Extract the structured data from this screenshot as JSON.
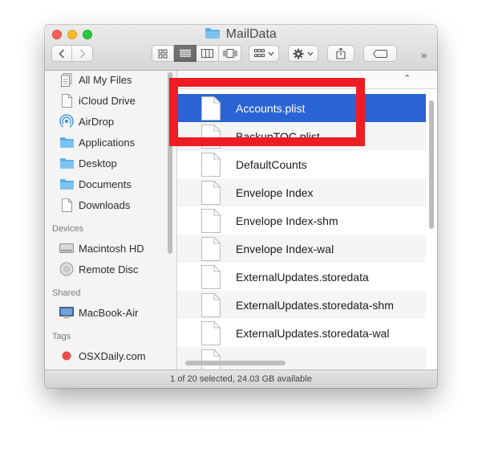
{
  "window": {
    "title": "MailData",
    "title_icon": "folder-icon",
    "controls": [
      "close",
      "minimize",
      "zoom"
    ]
  },
  "toolbar": {
    "back_icon": "chevron-left-icon",
    "forward_icon": "chevron-right-icon",
    "views": [
      {
        "name": "icon-view",
        "active": false
      },
      {
        "name": "list-view",
        "active": true
      },
      {
        "name": "column-view",
        "active": false
      },
      {
        "name": "cover-flow-view",
        "active": false
      }
    ],
    "arrange_icon": "arrange-icon",
    "action_icon": "gear-icon",
    "share_icon": "share-icon",
    "tag_icon": "tag-icon",
    "overflow_label": "»"
  },
  "sidebar": {
    "favorites": [
      {
        "label": "All My Files",
        "icon": "all-files-icon"
      },
      {
        "label": "iCloud Drive",
        "icon": "document-icon"
      },
      {
        "label": "AirDrop",
        "icon": "airdrop-icon"
      },
      {
        "label": "Applications",
        "icon": "folder-icon"
      },
      {
        "label": "Desktop",
        "icon": "folder-icon"
      },
      {
        "label": "Documents",
        "icon": "folder-icon"
      },
      {
        "label": "Downloads",
        "icon": "document-icon"
      }
    ],
    "devices_header": "Devices",
    "devices": [
      {
        "label": "Macintosh HD",
        "icon": "hard-drive-icon"
      },
      {
        "label": "Remote Disc",
        "icon": "disc-icon"
      }
    ],
    "shared_header": "Shared",
    "shared": [
      {
        "label": "MacBook-Air",
        "icon": "computer-icon"
      }
    ],
    "tags_header": "Tags",
    "tags": [
      {
        "label": "OSXDaily.com",
        "icon": "tag-dot-icon",
        "color": "#e94d4d"
      }
    ]
  },
  "list": {
    "sort_indicator": "⌃",
    "files": [
      {
        "name": "Accounts.plist",
        "selected": true
      },
      {
        "name": "BackupTOC.plist",
        "selected": false
      },
      {
        "name": "DefaultCounts",
        "selected": false
      },
      {
        "name": "Envelope Index",
        "selected": false
      },
      {
        "name": "Envelope Index-shm",
        "selected": false
      },
      {
        "name": "Envelope Index-wal",
        "selected": false
      },
      {
        "name": "ExternalUpdates.storedata",
        "selected": false
      },
      {
        "name": "ExternalUpdates.storedata-shm",
        "selected": false
      },
      {
        "name": "ExternalUpdates.storedata-wal",
        "selected": false
      }
    ]
  },
  "status": "1 of 20 selected, 24.03 GB available",
  "highlight_color": "#ee1c23",
  "selection_color": "#2a64d4"
}
